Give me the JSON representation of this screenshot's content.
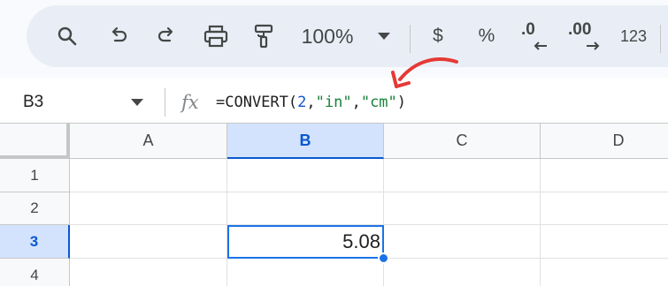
{
  "toolbar": {
    "items": [
      {
        "name": "search-icon"
      },
      {
        "name": "undo-icon"
      },
      {
        "name": "redo-icon"
      },
      {
        "name": "print-icon"
      },
      {
        "name": "paint-format-icon"
      }
    ],
    "zoom": "100%",
    "currency_label": "$",
    "percent_label": "%",
    "decrease_decimal_label": ".0",
    "increase_decimal_label": ".00",
    "more_formats_label": "123"
  },
  "formula_bar": {
    "name_box": "B3",
    "fx_label": "fx",
    "formula": {
      "prefix": "=CONVERT(",
      "number": "2",
      "comma1": ",",
      "from_unit": "\"in\"",
      "comma2": ",",
      "to_unit": "\"cm\"",
      "suffix": ")"
    }
  },
  "grid": {
    "columns": [
      "A",
      "B",
      "C",
      "D"
    ],
    "rows": [
      "1",
      "2",
      "3",
      "4"
    ],
    "active_cell": {
      "ref": "B3",
      "value": "5.08"
    }
  },
  "colors": {
    "accent": "#1a73e8",
    "annotation_arrow": "#e53935",
    "formula_number": "#1155cc",
    "formula_string": "#188038"
  }
}
